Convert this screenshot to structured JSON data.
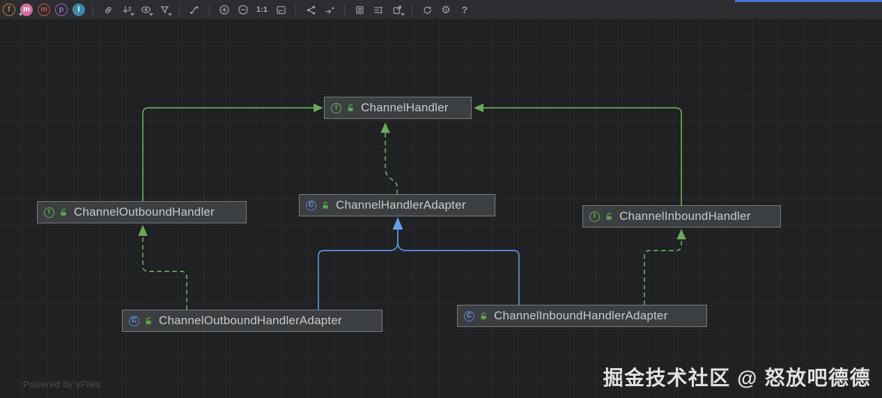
{
  "toolbar": {
    "toggles": [
      {
        "name": "fields-toggle",
        "letter": "f",
        "color": "#c77e3f",
        "filled": false
      },
      {
        "name": "methods-star-toggle",
        "letter": "m",
        "color": "#cf6d9e",
        "filled": true,
        "star": true
      },
      {
        "name": "constructors-toggle",
        "letter": "m",
        "color": "#c75450",
        "filled": false
      },
      {
        "name": "properties-toggle",
        "letter": "p",
        "color": "#8f6bc9",
        "filled": false
      },
      {
        "name": "inner-classes-toggle",
        "letter": "I",
        "color": "#3d87a8",
        "filled": true
      }
    ],
    "zoom_label": "1:1",
    "help_label": "?"
  },
  "diagram": {
    "nodes": [
      {
        "id": "channel-handler",
        "label": "ChannelHandler",
        "stereotype": "interface",
        "icon_letter": "I"
      },
      {
        "id": "channel-outbound-handler",
        "label": "ChannelOutboundHandler",
        "stereotype": "interface",
        "icon_letter": "I"
      },
      {
        "id": "channel-handler-adapter",
        "label": "ChannelHandlerAdapter",
        "stereotype": "class",
        "icon_letter": "C"
      },
      {
        "id": "channel-inbound-handler",
        "label": "ChannelInboundHandler",
        "stereotype": "interface",
        "icon_letter": "I"
      },
      {
        "id": "channel-outbound-handler-adapter",
        "label": "ChannelOutboundHandlerAdapter",
        "stereotype": "class",
        "icon_letter": "C"
      },
      {
        "id": "channel-inbound-handler-adapter",
        "label": "ChannelInboundHandlerAdapter",
        "stereotype": "class",
        "icon_letter": "C"
      }
    ],
    "edges": [
      {
        "from": "ChannelOutboundHandler",
        "to": "ChannelHandler",
        "relation": "extends",
        "style": "solid-green"
      },
      {
        "from": "ChannelInboundHandler",
        "to": "ChannelHandler",
        "relation": "extends",
        "style": "solid-green"
      },
      {
        "from": "ChannelHandlerAdapter",
        "to": "ChannelHandler",
        "relation": "implements",
        "style": "dashed-green"
      },
      {
        "from": "ChannelOutboundHandlerAdapter",
        "to": "ChannelOutboundHandler",
        "relation": "implements",
        "style": "dashed-green"
      },
      {
        "from": "ChannelInboundHandlerAdapter",
        "to": "ChannelInboundHandler",
        "relation": "implements",
        "style": "dashed-green"
      },
      {
        "from": "ChannelOutboundHandlerAdapter",
        "to": "ChannelHandlerAdapter",
        "relation": "extends",
        "style": "solid-blue"
      },
      {
        "from": "ChannelInboundHandlerAdapter",
        "to": "ChannelHandlerAdapter",
        "relation": "extends",
        "style": "solid-blue"
      }
    ]
  },
  "watermark": "Powered by yFiles",
  "attribution": "掘金技术社区 @ 怒放吧德德",
  "colors": {
    "edge_green": "#6aaa5a",
    "edge_blue": "#5c93e5",
    "interface_icon_green": "#5fb552",
    "class_icon_blue": "#5b87dd",
    "node_background": "#3c3f41",
    "node_border": "#7b7e81",
    "canvas_background": "#1f2123",
    "toolbar_background": "#2b2d30",
    "top_accent_bar": "#4470d4"
  }
}
